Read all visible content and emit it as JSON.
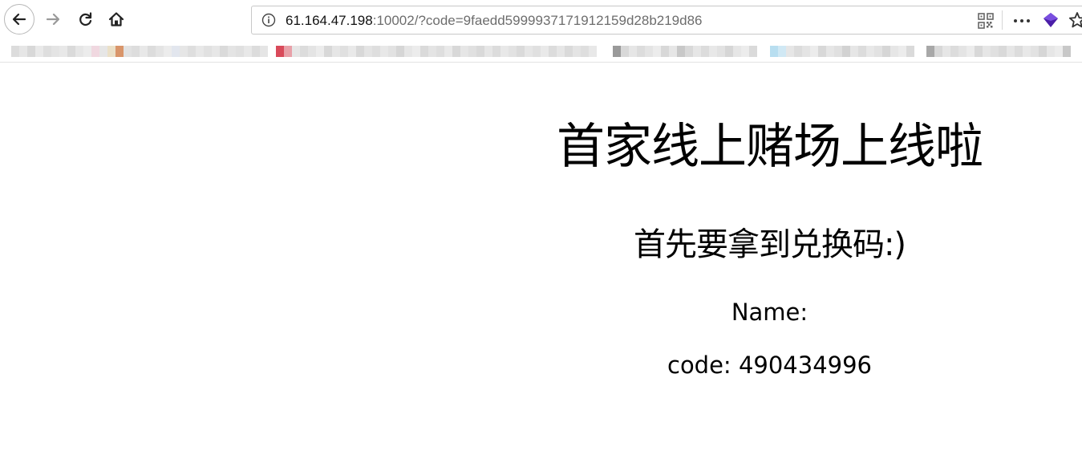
{
  "browser": {
    "url_host": "61.164.47.198",
    "url_rest": ":10002/?code=9faedd5999937171912159d28b219d86"
  },
  "page": {
    "title": "首家线上赌场上线啦",
    "subtitle": "首先要拿到兑换码:)",
    "name_label": "Name:",
    "name_value": "",
    "code_label": "code:",
    "code_value": "490434996"
  },
  "icons": {
    "back": "back-arrow-icon",
    "forward": "forward-arrow-icon",
    "reload": "reload-icon",
    "home": "home-icon",
    "info": "info-icon",
    "qr": "qr-code-icon",
    "more": "more-dots-icon",
    "extension": "extension-icon",
    "bookmark": "star-icon"
  },
  "colors": {
    "extension_accent": "#4b1fa8",
    "url_secondary": "#6d6d6d"
  }
}
